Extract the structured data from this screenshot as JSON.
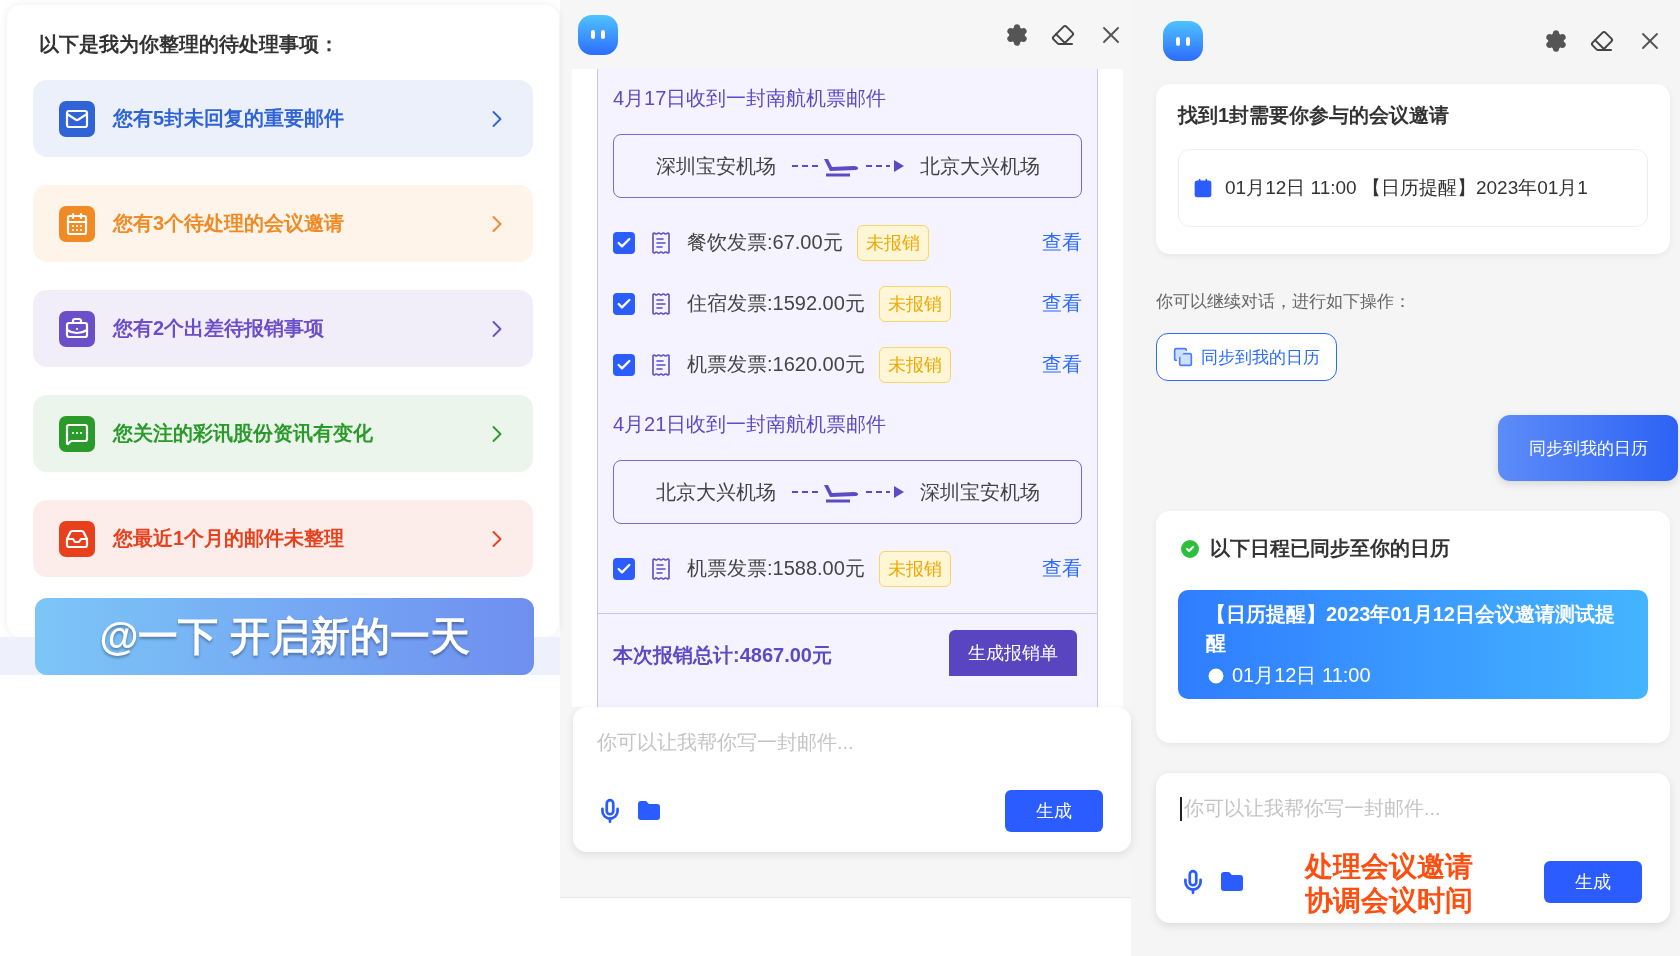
{
  "todo_panel": {
    "heading": "以下是我为你整理的待处理事项：",
    "items": [
      {
        "kind": "mail",
        "label": "您有5封未回复的重要邮件",
        "color": "#2f63d6"
      },
      {
        "kind": "calendar",
        "label": "您有3个待处理的会议邀请",
        "color": "#f08a24"
      },
      {
        "kind": "briefcase",
        "label": "您有2个出差待报销事项",
        "color": "#6b4fc8"
      },
      {
        "kind": "chat",
        "label": "您关注的彩讯股份资讯有变化",
        "color": "#2a9a2a"
      },
      {
        "kind": "inbox",
        "label": "您最近1个月的邮件未整理",
        "color": "#e8401c"
      }
    ],
    "banner": "@一下 开启新的一天"
  },
  "expense_panel": {
    "trips": [
      {
        "heading": "4月17日收到一封南航机票邮件",
        "from": "深圳宝安机场",
        "to": "北京大兴机场",
        "invoices": [
          {
            "label": "餐饮发票:67.00元",
            "status": "未报销",
            "checked": true,
            "link": "查看"
          },
          {
            "label": "住宿发票:1592.00元",
            "status": "未报销",
            "checked": true,
            "link": "查看"
          },
          {
            "label": "机票发票:1620.00元",
            "status": "未报销",
            "checked": true,
            "link": "查看"
          }
        ]
      },
      {
        "heading": "4月21日收到一封南航机票邮件",
        "from": "北京大兴机场",
        "to": "深圳宝安机场",
        "invoices": [
          {
            "label": "机票发票:1588.00元",
            "status": "未报销",
            "checked": true,
            "link": "查看"
          }
        ]
      }
    ],
    "total": "本次报销总计:4867.00元",
    "generate_button": "生成报销单",
    "input": {
      "placeholder": "你可以让我帮你写一封邮件...",
      "submit": "生成"
    }
  },
  "meeting_panel": {
    "found_title": "找到1封需要你参与的会议邀请",
    "invite": "01月12日 11:00 【日历提醒】2023年01月1",
    "hint": "你可以继续对话，进行如下操作：",
    "action_button": "同步到我的日历",
    "user_message": "同步到我的日历",
    "synced_title": "以下日程已同步至你的日历",
    "event_title": "【日历提醒】2023年01月12日会议邀请测试提醒",
    "event_time": "01月12日 11:00",
    "input": {
      "placeholder": "你可以让我帮你写一封邮件...",
      "submit": "生成"
    },
    "caption": [
      "处理会议邀请",
      "协调会议时间"
    ]
  }
}
